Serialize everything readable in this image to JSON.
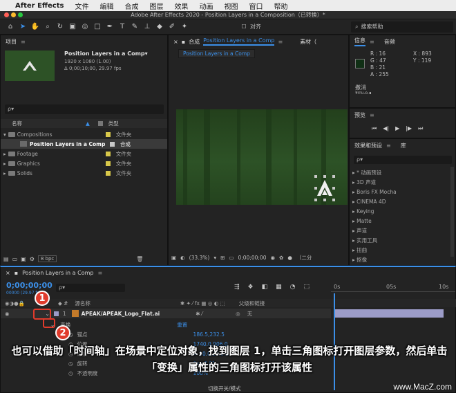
{
  "menubar": {
    "app": "After Effects",
    "items": [
      "文件",
      "编辑",
      "合成",
      "图层",
      "效果",
      "动画",
      "视图",
      "窗口",
      "帮助"
    ]
  },
  "window_title": "Adobe After Effects 2020 - Position Layers in a Composition（已转换）*",
  "toolbar": {
    "align_label": "对齐",
    "search_help": "搜索帮助"
  },
  "project": {
    "title": "项目",
    "comp_name": "Position Layers in a Comp▾",
    "comp_size": "1920 x 1080 (1.00)",
    "comp_duration": "Δ 0;00;10;00, 29.97 fps",
    "search_placeholder": "ρ▾",
    "col_name": "名称",
    "col_type": "类型",
    "items": [
      {
        "name": "Compositions",
        "type": "文件夹",
        "color": "#d8c84a"
      },
      {
        "name": "Position Layers in a Comp",
        "type": "合成",
        "color": "#c9c9c9"
      },
      {
        "name": "Footage",
        "type": "文件夹",
        "color": "#d8c84a"
      },
      {
        "name": "Graphics",
        "type": "文件夹",
        "color": "#d8c84a"
      },
      {
        "name": "Solids",
        "type": "文件夹",
        "color": "#d8c84a"
      }
    ],
    "bpc": "8 bpc"
  },
  "composition": {
    "tab_prefix": "合成",
    "tab_name": "Position Layers in a Comp",
    "footage_tab": "素材（",
    "breadcrumb": "Position Layers in a Comp",
    "zoom": "(33.3%)",
    "timecode": "0;00;00;00",
    "resolution": "（二分"
  },
  "info": {
    "title": "信息",
    "audio": "音频",
    "R": "R : 16",
    "G": "G : 47",
    "B": "B : 21",
    "A": "A : 255",
    "X": "X : 893",
    "Y": "Y : 119",
    "undo": "撤消",
    "undo_sub": "¥rru.o.∎"
  },
  "preview": {
    "title": "预览"
  },
  "effects": {
    "title": "效果和预设",
    "lib": "库",
    "search_placeholder": "ρ▾",
    "items": [
      "* 动画预设",
      "3D 声道",
      "Boris FX Mocha",
      "CINEMA 4D",
      "Keying",
      "Matte",
      "声道",
      "实用工具",
      "扭曲",
      "抠像"
    ]
  },
  "timeline": {
    "tab": "Position Layers in a Comp",
    "timecode": "0;00;00;00",
    "sub_time": "00000 (29.97 fps)",
    "search_placeholder": "ρ▾",
    "col_source": "源名称",
    "col_parent": "父级和链接",
    "ruler": [
      "0s",
      "05s",
      "10s"
    ],
    "layer_num": "1",
    "layer_name": "APEAK/APEAK_Logo_Flat.ai",
    "parent": "无",
    "transform": "变换",
    "reset": "重置",
    "props": [
      {
        "name": "锚点",
        "value": "186.5,232.5"
      },
      {
        "name": "位置",
        "value": "1740.0,906.0"
      },
      {
        "name": "缩放",
        "value": "∞ 10.0,10.0%"
      },
      {
        "name": "旋转",
        "value": "0x+0.0°"
      },
      {
        "name": "不透明度",
        "value": "100%"
      }
    ],
    "footer": "切换开关/模式"
  },
  "annotation": {
    "badge1": "1",
    "badge2": "2",
    "caption": "也可以借助「时间轴」在场景中定位对象，找到图层 1，单击三角图标打开图层参数，然后单击「变换」属性的三角图标打开该属性",
    "watermark": "www.MacZ.com"
  },
  "colors": {
    "accent": "#3b8fe8",
    "badge": "#e03b2c",
    "layer_bar": "#9c9cc8",
    "forest": "#2a4a22"
  }
}
